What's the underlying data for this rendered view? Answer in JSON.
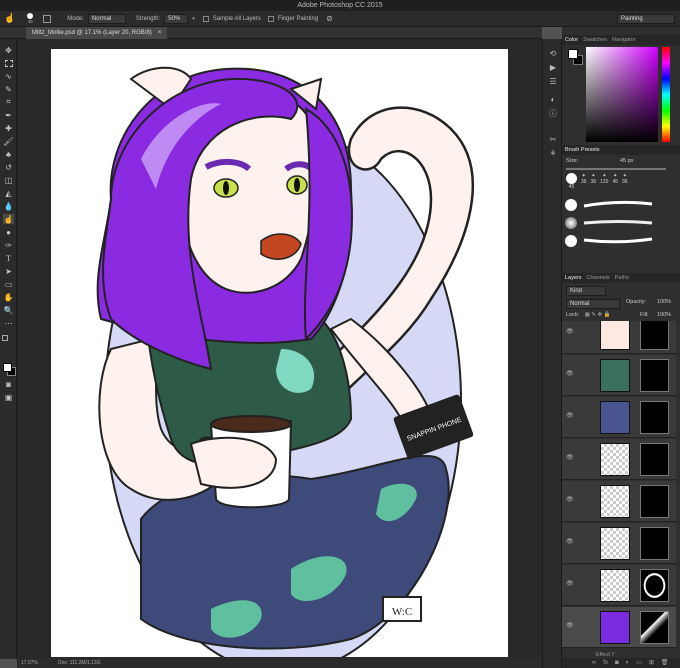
{
  "app": {
    "title": "Adobe Photoshop CC 2015"
  },
  "options": {
    "brush_size": "45",
    "mode_label": "Mode:",
    "mode_value": "Normal",
    "strength_label": "Strength:",
    "strength_value": "50%",
    "sample_all": "Sample All Layers",
    "finger_painting": "Finger Painting",
    "workspace": "Painting"
  },
  "document": {
    "tab_title": "Mittz_Mollie.psd @ 17.1% (Layer 20, RGB/8)",
    "close": "×"
  },
  "status": {
    "zoom": "17.07%",
    "doc": "Doc: 111.2M/1.13G"
  },
  "color_panel": {
    "tabs": [
      "Color",
      "Swatches",
      "Navigator"
    ],
    "fg": "#ffffff",
    "bg": "#000000",
    "hue": "#d000ff"
  },
  "brush_presets": {
    "title": "Brush Presets",
    "size_label": "Size:",
    "size_value": "45 px",
    "sizes": [
      "45",
      "36",
      "36",
      "120",
      "45",
      "36"
    ]
  },
  "layers_panel": {
    "tabs": [
      "Layers",
      "Channels",
      "Paths"
    ],
    "kind": "Kind",
    "blend": "Normal",
    "opacity_label": "Opacity:",
    "opacity_value": "100%",
    "lock_label": "Lock:",
    "fill_label": "Fill:",
    "fill_value": "100%",
    "bottom_label": "Effect 7"
  },
  "artwork": {
    "phone_text": "SNAPPIN PHONE",
    "signature": "W:C"
  },
  "colors": {
    "hair": "#8a2be2",
    "tank": "#2e5a48",
    "jeans": "#3d4a7a",
    "oval": "#d5d9f5",
    "skin": "#fde9e2",
    "lips": "#c2461f"
  }
}
